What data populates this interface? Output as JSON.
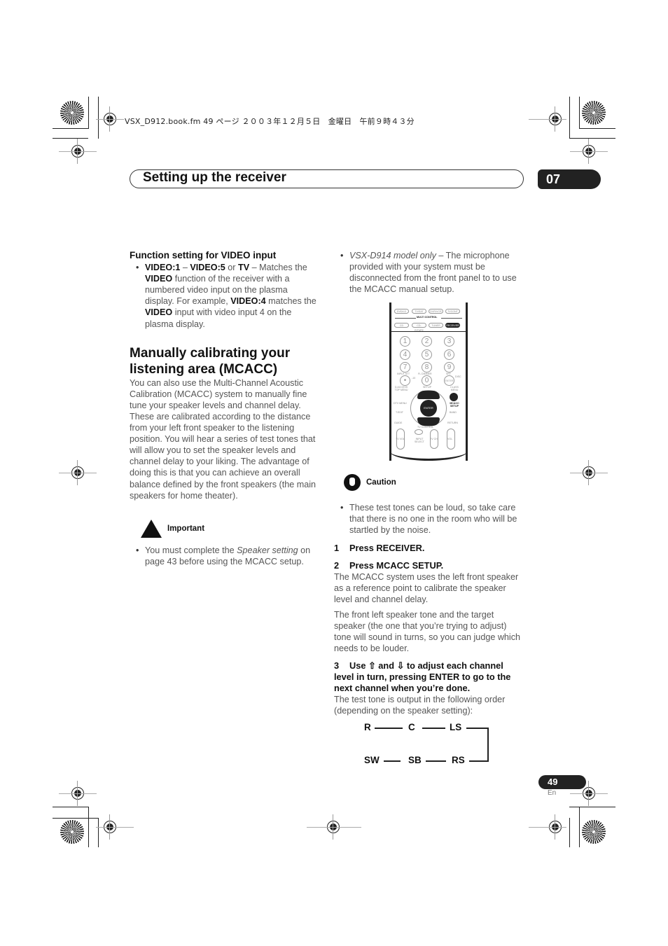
{
  "file_header": "VSX_D912.book.fm  49 ページ  ２００３年１２月５日　金曜日　午前９時４３分",
  "chapter": {
    "title": "Setting up the receiver",
    "number": "07"
  },
  "left_column": {
    "function_setting": {
      "heading": "Function setting for VIDEO input",
      "bullet": {
        "b1": "VIDEO:1",
        "t1": " – ",
        "b2": "VIDEO:5",
        "t2": " or ",
        "b3": "TV",
        "t3": " – Matches the ",
        "b4": "VIDEO",
        "t4": " function of the receiver with a numbered video input on the plasma display. For example, ",
        "b5": "VIDEO:4",
        "t5": " matches the ",
        "b6": "VIDEO",
        "t6": " input with video input 4 on the plasma display."
      }
    },
    "section_heading": "Manually calibrating your listening area (MCACC)",
    "intro": "You can also use the Multi-Channel Acoustic Calibration (MCACC) system to manually fine tune your speaker levels and channel delay. These are calibrated according to the distance from your left front speaker to the listening position. You will hear a series of test tones that will allow you to set the speaker levels and channel delay to your liking. The advantage of doing this is that you can achieve an overall balance defined by the front speakers (the main speakers for home theater).",
    "important": {
      "label": "Important",
      "bullet_pre": "You must complete the ",
      "bullet_italic": "Speaker setting",
      "bullet_post": " on page 43 before using the MCACC setup."
    }
  },
  "right_column": {
    "model_note": {
      "italic": "VSX-D914 model only",
      "text": " – The microphone provided with your system must be disconnected from the front panel to to use the MCACC manual setup."
    },
    "remote": {
      "top_row": [
        "DVD/LD",
        "TV/SAT",
        "DVR/VCR",
        "TVCONT"
      ],
      "multi_control_label": "MULTI CONTROL",
      "second_row": [
        "CD",
        "CD-R/TAPE",
        "TUNER",
        "RECEIVER"
      ],
      "numbers": [
        "1",
        "2",
        "3",
        "4",
        "5",
        "6",
        "7",
        "8",
        "9",
        "•",
        "0",
        "ENTER"
      ],
      "labels": {
        "input_att": "INPUT ATT",
        "fl_dimmer": "FL DIMMER",
        "srt": "SRT",
        "minus10": "-10",
        "disc": "DISC",
        "d_access": "D.ACCESS TOP MENU",
        "setup": "SETUP",
        "class_menu": "CLASS MENU",
        "dtv_menu": "DTV MENU",
        "mcacc_setup": "MCACC SETUP",
        "tune_left": "ST",
        "tune_right": "ST",
        "t_edit": "T.EDIT",
        "band": "BAND",
        "guide": "GUIDE",
        "return": "RETURN",
        "enter": "ENTER",
        "tv_control": "TV CONTROL",
        "tv_vol": "TV VOL",
        "input_select": "INPUT SELECT",
        "tv_ch": "TV CH",
        "vol": "VOL"
      }
    },
    "caution": {
      "label": "Caution",
      "bullet": "These test tones can be loud, so take care that there is no one in the room who will be startled by the noise."
    },
    "steps": [
      {
        "num": "1",
        "text": "Press RECEIVER."
      },
      {
        "num": "2",
        "text": "Press MCACC SETUP."
      },
      {
        "num": "3",
        "text": "Use ⇧ and ⇩ to adjust each channel level in turn, pressing ENTER to go to the next channel when you’re done."
      }
    ],
    "step2_paragraphs": [
      "The MCACC system uses the left front speaker as a reference point to calibrate the speaker level and channel delay.",
      "The front left speaker tone and the target speaker (the one that you’re trying to adjust) tone will sound in turns, so you can judge which needs to be louder."
    ],
    "step3_paragraph": "The test tone is output in the following order (depending on the speaker setting):",
    "channel_order": {
      "row1": [
        "R",
        "C",
        "LS"
      ],
      "row2": [
        "SW",
        "SB",
        "RS"
      ]
    }
  },
  "footer": {
    "page_number": "49",
    "language": "En"
  }
}
